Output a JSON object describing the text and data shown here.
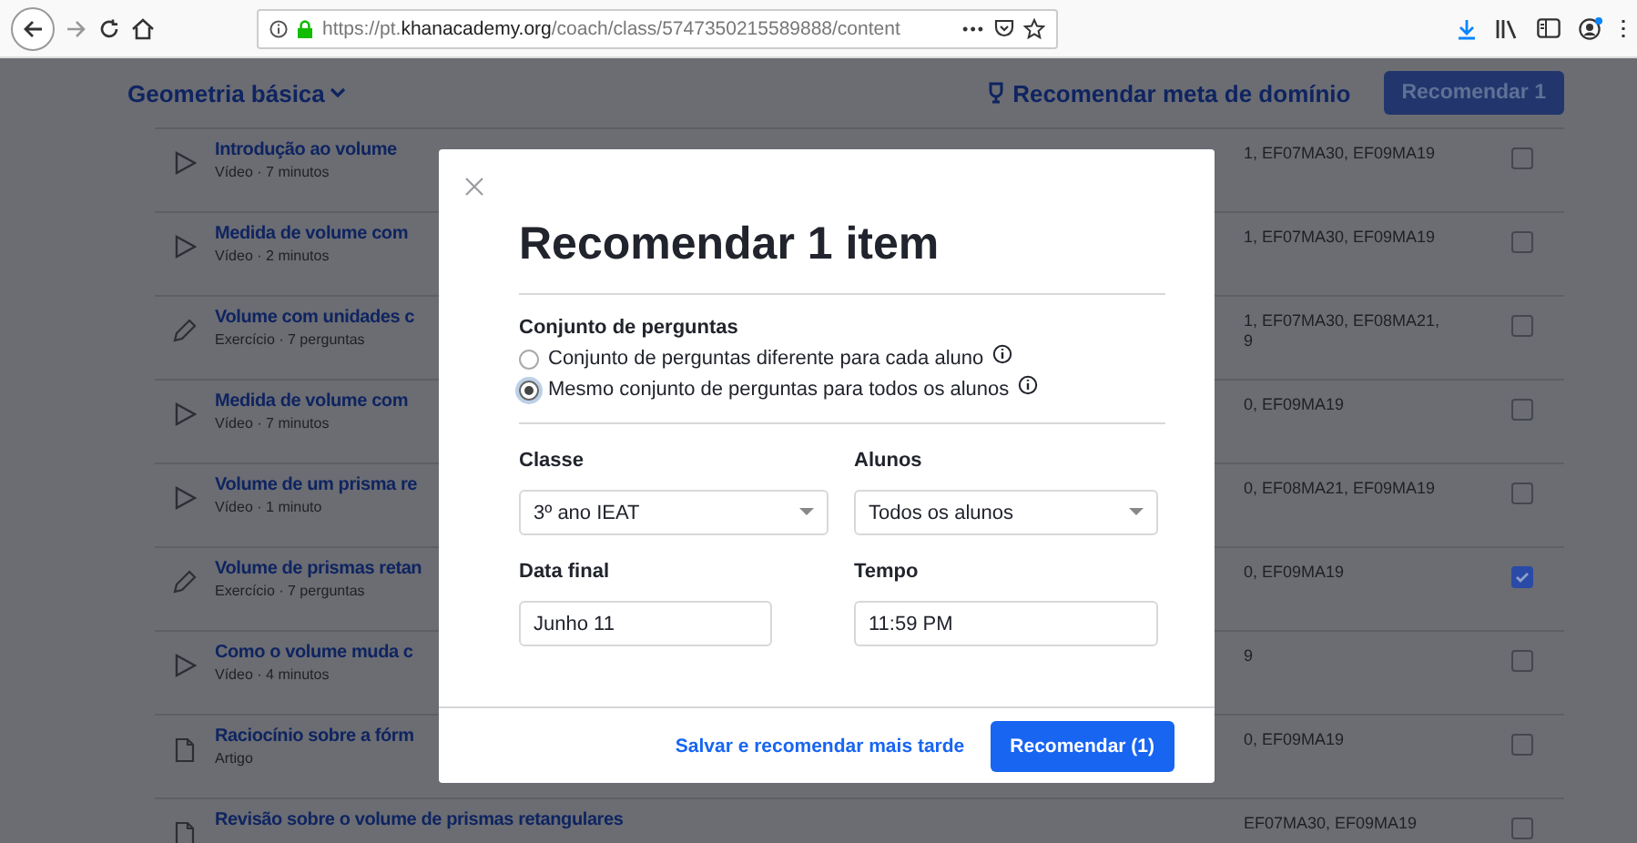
{
  "browser": {
    "url_prefix": "https://pt.",
    "url_domain": "khanacademy.org",
    "url_path": "/coach/class/5747350215589888/content",
    "menu_dots": "•••"
  },
  "header": {
    "course": "Geometria básica",
    "recommend_goal": "Recomendar meta de domínio",
    "recommend_button": "Recomendar 1"
  },
  "rows": [
    {
      "kind": "video",
      "title": "Introdução ao volume",
      "subtitle": "Vídeo · 7 minutos",
      "standards": "1, EF07MA30, EF09MA19",
      "checked": false
    },
    {
      "kind": "video",
      "title": "Medida de volume com",
      "subtitle": "Vídeo · 2 minutos",
      "standards": "1, EF07MA30, EF09MA19",
      "checked": false
    },
    {
      "kind": "exercise",
      "title": "Volume com unidades c",
      "subtitle": "Exercício · 7 perguntas",
      "standards": "1, EF07MA30, EF08MA21,",
      "standards_2": "9",
      "checked": false
    },
    {
      "kind": "video",
      "title": "Medida de volume com",
      "subtitle": "Vídeo · 7 minutos",
      "standards": "0, EF09MA19",
      "checked": false
    },
    {
      "kind": "video",
      "title": "Volume de um prisma re",
      "subtitle": "Vídeo · 1 minuto",
      "standards": "0, EF08MA21, EF09MA19",
      "checked": false
    },
    {
      "kind": "exercise",
      "title": "Volume de prismas retan",
      "subtitle": "Exercício · 7 perguntas",
      "standards": "0, EF09MA19",
      "checked": true
    },
    {
      "kind": "video",
      "title": "Como o volume muda c",
      "subtitle": "Vídeo · 4 minutos",
      "standards": "9",
      "checked": false
    },
    {
      "kind": "article",
      "title": "Raciocínio sobre a fórm",
      "subtitle": "Artigo",
      "standards": "0, EF09MA19",
      "checked": false
    },
    {
      "kind": "article",
      "title": "Revisão sobre o volume de prismas retangulares",
      "standards": "EF07MA30, EF09MA19",
      "checked": false
    }
  ],
  "dialog": {
    "title": "Recomendar 1 item",
    "question_set_label": "Conjunto de perguntas",
    "options": [
      {
        "label": "Conjunto de perguntas diferente para cada aluno",
        "selected": false
      },
      {
        "label": "Mesmo conjunto de perguntas para todos os alunos",
        "selected": true
      }
    ],
    "fields": [
      {
        "kind": "select",
        "label": "Classe",
        "value": "3º ano IEAT"
      },
      {
        "kind": "select",
        "label": "Alunos",
        "value": "Todos os alunos"
      },
      {
        "kind": "text",
        "label": "Data final",
        "value": "Junho 11"
      },
      {
        "kind": "text",
        "label": "Tempo",
        "value": "11:59 PM"
      }
    ],
    "save_later": "Salvar e recomendar mais tarde",
    "submit": "Recomendar (1)"
  }
}
